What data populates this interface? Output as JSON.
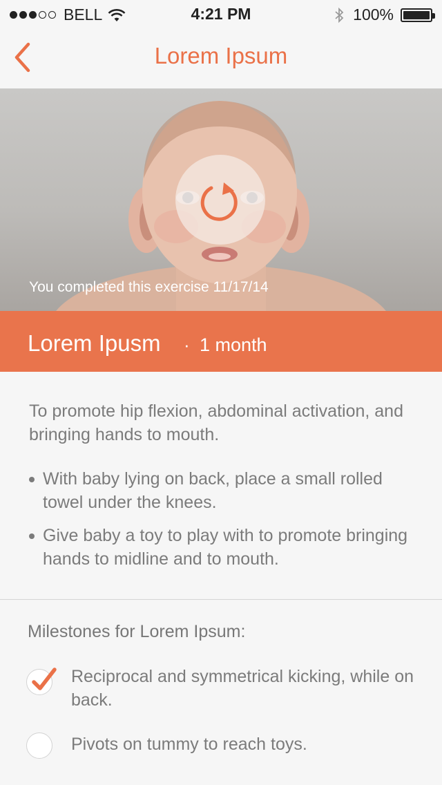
{
  "status_bar": {
    "carrier": "BELL",
    "time": "4:21 PM",
    "battery": "100%",
    "signal_bars_filled": 3,
    "signal_bars_total": 5
  },
  "nav": {
    "title": "Lorem Ipsum",
    "back_icon": "chevron-left-icon"
  },
  "hero": {
    "completed_text": "You completed this exercise 11/17/14",
    "replay_icon": "replay-icon"
  },
  "exercise": {
    "title": "Lorem Ipusm",
    "separator": "·",
    "age": "1 month"
  },
  "description": {
    "intro": "To promote hip flexion, abdominal activation, and bringing hands to mouth.",
    "bullets": [
      "With baby lying on back, place a small rolled towel under the knees.",
      "Give baby a toy to play with to promote bringing hands to midline and to mouth."
    ]
  },
  "milestones": {
    "heading": "Milestones for Lorem Ipsum:",
    "items": [
      {
        "label": "Reciprocal and symmetrical kicking, while on back.",
        "checked": true
      },
      {
        "label": "Pivots on tummy to reach toys.",
        "checked": false
      }
    ]
  },
  "colors": {
    "accent": "#ea7148",
    "banner": "#e9744c",
    "background": "#f6f6f6",
    "text": "#7b7b7b"
  }
}
